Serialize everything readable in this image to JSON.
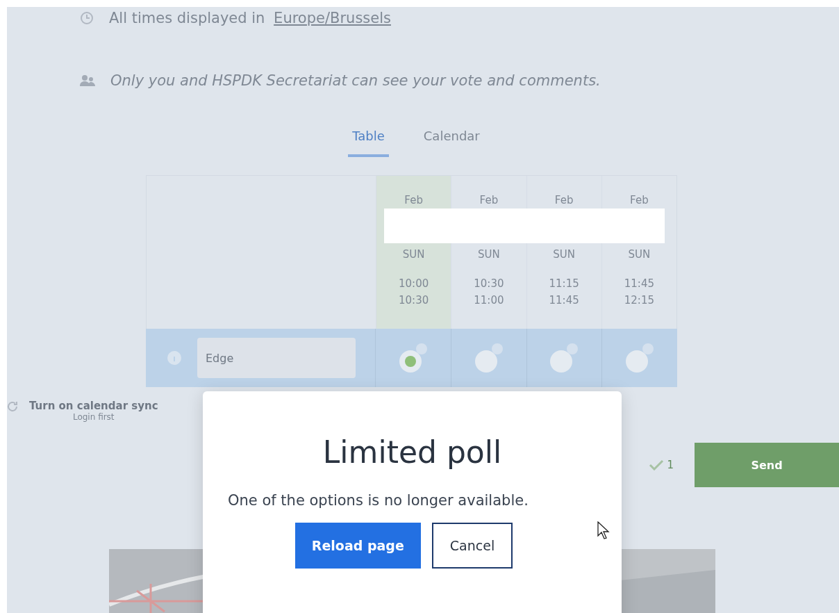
{
  "page": {
    "timezone_note": {
      "text": "All times displayed in",
      "link": "Europe/Brussels"
    },
    "privacy_note": "Only you and HSPDK Secretariat can see your vote and comments.",
    "view_tabs": [
      {
        "label": "Table",
        "selected": true
      },
      {
        "label": "Calendar",
        "selected": false
      }
    ],
    "options": [
      {
        "month": "Feb",
        "weekday": "SUN",
        "start": "10:00",
        "end": "10:30",
        "selected": true,
        "checked": true
      },
      {
        "month": "Feb",
        "weekday": "SUN",
        "start": "10:30",
        "end": "11:00",
        "selected": false,
        "checked": false
      },
      {
        "month": "Feb",
        "weekday": "SUN",
        "start": "11:15",
        "end": "11:45",
        "selected": false,
        "checked": false
      },
      {
        "month": "Feb",
        "weekday": "SUN",
        "start": "11:45",
        "end": "12:15",
        "selected": false,
        "checked": false
      }
    ],
    "participant": {
      "name": "Edge"
    },
    "calendar_sync": {
      "label": "Turn on calendar sync",
      "sub": "Login first"
    },
    "vote_count": "1",
    "send_button": "Send"
  },
  "dialog": {
    "title": "Limited poll",
    "message": "One of the options is no longer available.",
    "buttons": [
      {
        "label": "Reload page",
        "kind": "primary"
      },
      {
        "label": "Cancel",
        "kind": "secondary"
      }
    ]
  }
}
